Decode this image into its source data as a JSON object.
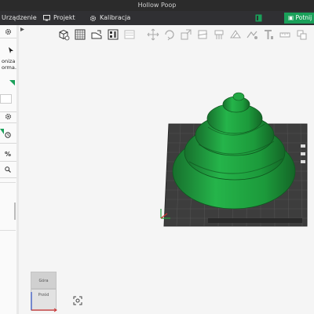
{
  "window": {
    "title": "Hollow Poop"
  },
  "menu": {
    "device": "Urządzenie",
    "project": "Projekt",
    "calibration": "Kalibracja",
    "slice_button": "Potnij akt"
  },
  "sidebar": {
    "text_line1": "oniza",
    "text_line2": "orma…",
    "percent_symbol": "%"
  },
  "navcube": {
    "top_label": "Góra",
    "front_label": "Przód"
  },
  "colors": {
    "accent": "#1aa05a",
    "model": "#1f9a3c",
    "menubar": "#303033",
    "plate": "#3a3a3a"
  },
  "icons": {
    "menu": [
      "monitor-icon",
      "gear-icon"
    ],
    "toolbar": [
      "add-cube-icon",
      "grid-icon",
      "orient-icon",
      "arrange-icon",
      "plate-icon",
      "move-icon",
      "rotate-icon",
      "scale-icon",
      "cut-icon",
      "support-icon",
      "seam-icon",
      "mmu-icon",
      "text-icon",
      "measure-icon"
    ]
  }
}
